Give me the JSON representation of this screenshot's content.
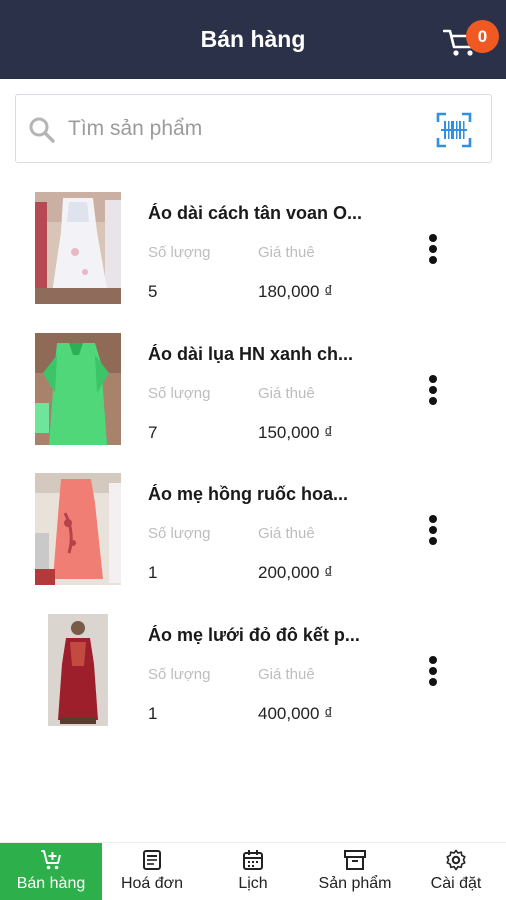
{
  "header": {
    "title": "Bán hàng",
    "cart_count": "0"
  },
  "search": {
    "placeholder": "Tìm sản phẩm"
  },
  "products": [
    {
      "name": "Áo dài cách tân voan O...",
      "qty_label": "Số lượng",
      "price_label": "Giá thuê",
      "qty": "5",
      "price": "180,000 ₫"
    },
    {
      "name": "Áo dài lụa HN xanh ch...",
      "qty_label": "Số lượng",
      "price_label": "Giá thuê",
      "qty": "7",
      "price": "150,000 ₫"
    },
    {
      "name": "Áo mẹ hồng ruốc hoa...",
      "qty_label": "Số lượng",
      "price_label": "Giá thuê",
      "qty": "1",
      "price": "200,000 ₫"
    },
    {
      "name": "Áo mẹ lưới đỏ đô kết p...",
      "qty_label": "Số lượng",
      "price_label": "Giá thuê",
      "qty": "1",
      "price": "400,000 ₫"
    }
  ],
  "nav": {
    "tabs": [
      {
        "label": "Bán hàng",
        "icon": "cart-plus-icon",
        "active": true
      },
      {
        "label": "Hoá đơn",
        "icon": "receipt-icon",
        "active": false
      },
      {
        "label": "Lịch",
        "icon": "calendar-icon",
        "active": false
      },
      {
        "label": "Sản phẩm",
        "icon": "archive-box-icon",
        "active": false
      },
      {
        "label": "Cài đặt",
        "icon": "gear-icon",
        "active": false
      }
    ]
  },
  "colors": {
    "header_bg": "#2b3149",
    "badge": "#f05a22",
    "accent_green": "#2db04b",
    "barcode_blue": "#2f8fe0"
  }
}
